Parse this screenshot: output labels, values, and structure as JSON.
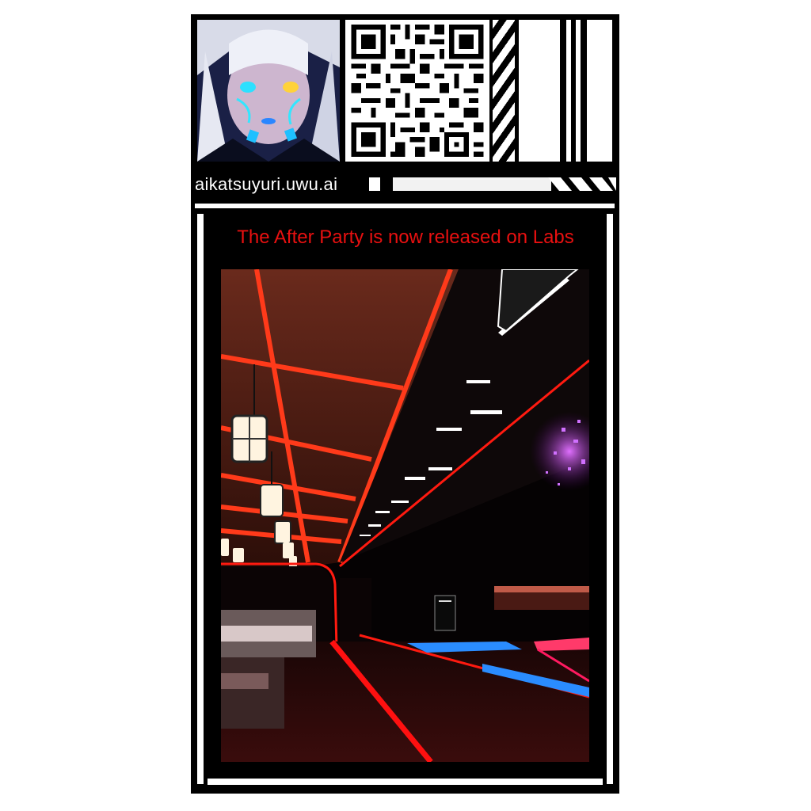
{
  "profile": {
    "avatar_icon": "anime-avatar-icon",
    "qr_icon": "qr-code-icon"
  },
  "link": {
    "url": "aikatsuyuri.uwu.ai"
  },
  "post": {
    "headline": "The After Party is now released on Labs"
  },
  "colors": {
    "accent": "#e81010",
    "background": "#000000",
    "frame": "#ffffff",
    "neon_red": "#ff2a1a",
    "neon_blue": "#1e88ff",
    "neon_purple": "#c040ff"
  }
}
